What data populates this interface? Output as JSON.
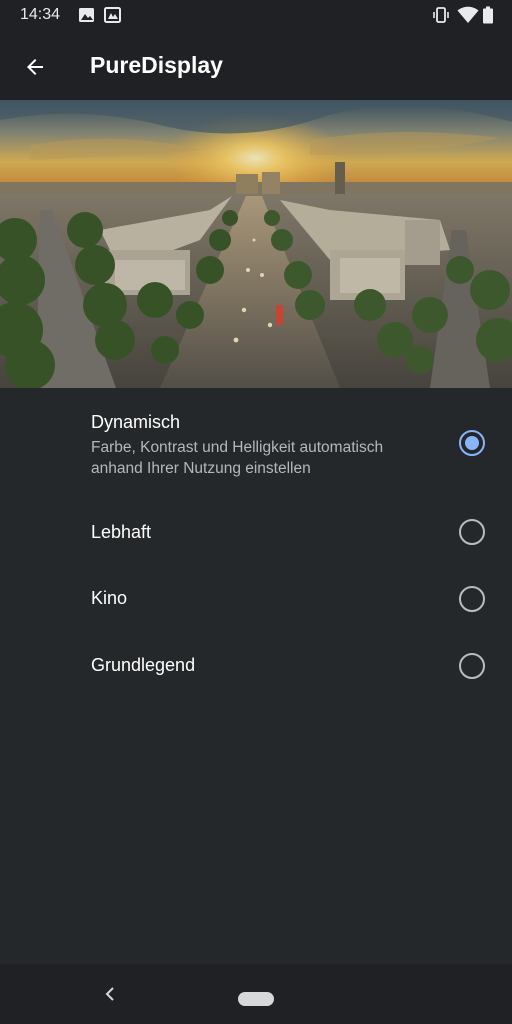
{
  "status_bar": {
    "time": "14:34",
    "left_icons": [
      "image-notification-icon",
      "gallery-notification-icon"
    ],
    "right_icons": [
      "vibrate-icon",
      "wifi-icon",
      "battery-icon"
    ]
  },
  "app_bar": {
    "back_icon": "arrow-left-icon",
    "title": "PureDisplay"
  },
  "hero_image": {
    "subject": "city avenue at sunset"
  },
  "options": [
    {
      "label": "Dynamisch",
      "description": "Farbe, Kontrast und Helligkeit automatisch anhand Ihrer Nutzung einstellen",
      "selected": true
    },
    {
      "label": "Lebhaft",
      "selected": false
    },
    {
      "label": "Kino",
      "selected": false
    },
    {
      "label": "Grundlegend",
      "selected": false
    }
  ],
  "nav_bar": {
    "back_icon": "chevron-left-icon",
    "home_icon": "home-pill-icon"
  },
  "colors": {
    "background": "#25282b",
    "bar": "#1f2124",
    "accent": "#8ab4f8",
    "secondary_text": "#b4b8bd"
  }
}
